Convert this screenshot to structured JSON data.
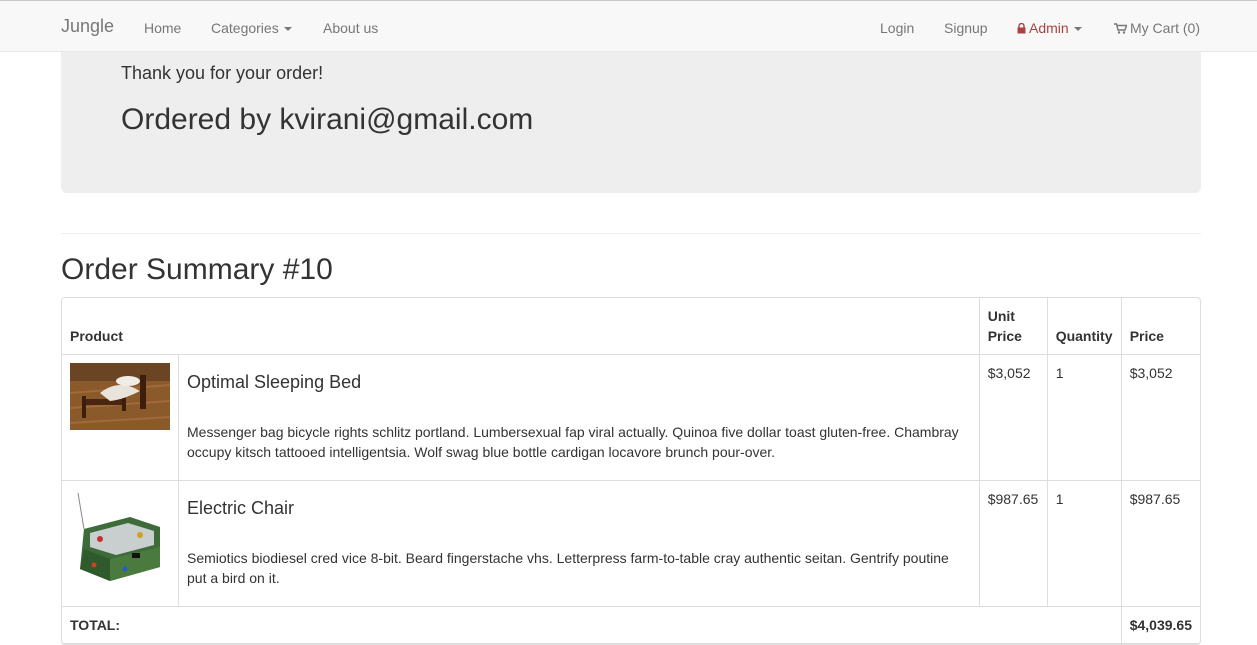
{
  "nav": {
    "brand": "Jungle",
    "home": "Home",
    "categories": "Categories",
    "about": "About us",
    "login": "Login",
    "signup": "Signup",
    "admin": "Admin",
    "cart": "My Cart (0)"
  },
  "jumbotron": {
    "thanks": "Thank you for your order!",
    "ordered_by": "Ordered by kvirani@gmail.com"
  },
  "summary": {
    "title": "Order Summary #10",
    "headers": {
      "product": "Product",
      "unit_price": "Unit Price",
      "quantity": "Quantity",
      "price": "Price"
    },
    "items": [
      {
        "name": "Optimal Sleeping Bed",
        "description": "Messenger bag bicycle rights schlitz portland. Lumbersexual fap viral actually. Quinoa five dollar toast gluten-free. Chambray occupy kitsch tattooed intelligentsia. Wolf swag blue bottle cardigan locavore brunch pour-over.",
        "unit_price": "$3,052",
        "quantity": "1",
        "price": "$3,052"
      },
      {
        "name": "Electric Chair",
        "description": "Semiotics biodiesel cred vice 8-bit. Beard fingerstache vhs. Letterpress farm-to-table cray authentic seitan. Gentrify poutine put a bird on it.",
        "unit_price": "$987.65",
        "quantity": "1",
        "price": "$987.65"
      }
    ],
    "total_label": "TOTAL:",
    "total_value": "$4,039.65"
  },
  "colors": {
    "navbar_bg": "#f8f8f8",
    "admin": "#a94442",
    "jumbotron_bg": "#eeeeee"
  }
}
